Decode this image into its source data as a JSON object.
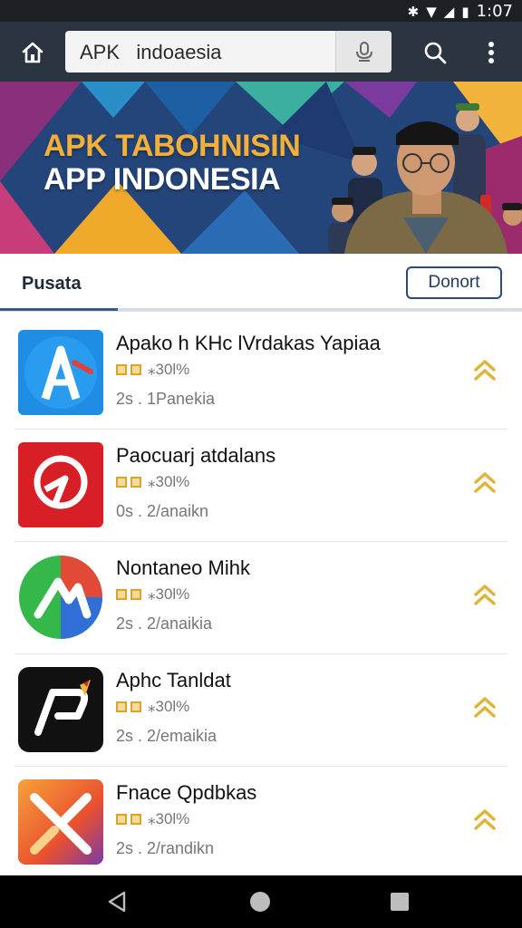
{
  "status_bar": {
    "time": "1:07"
  },
  "search": {
    "query": "APK   indoaesia"
  },
  "banner": {
    "title": "APK TABOHNISIN",
    "subtitle": "APP INDONESIA"
  },
  "section": {
    "title": "Pusata",
    "action_label": "Donort"
  },
  "apps": [
    {
      "name": "Apako h KHc lVrdakas Yapiaa",
      "rating": "⁎30l%",
      "meta": "2s . 1Panekia",
      "icon": "app-store-a-icon"
    },
    {
      "name": "Paocuarj atdalans",
      "rating": "⁎30l%",
      "meta": "0s . 2/anaikn",
      "icon": "red-bird-logo-icon"
    },
    {
      "name": "Nontaneo Mihk",
      "rating": "⁎30l%",
      "meta": "2s . 2/anaikia",
      "icon": "green-blue-arrow-logo-icon"
    },
    {
      "name": "Aphc Tanldat",
      "rating": "⁎30l%",
      "meta": "2s . 2/emaikia",
      "icon": "black-pen-logo-icon"
    },
    {
      "name": "Fnace Qpdbkas",
      "rating": "⁎30l%",
      "meta": "2s . 2/randikn",
      "icon": "orange-x-logo-icon"
    }
  ],
  "colors": {
    "app_bar": "#2b3441",
    "accent": "#2e4a72",
    "upgrade": "#e0b43a"
  }
}
